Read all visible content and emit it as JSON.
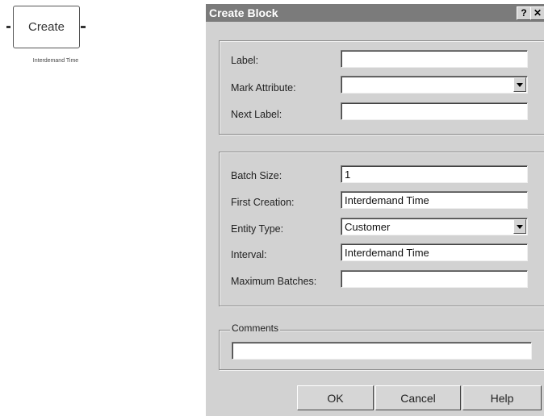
{
  "block": {
    "label": "Create",
    "caption": "Interdemand Time"
  },
  "dialog": {
    "title": "Create Block",
    "help_glyph": "?",
    "close_glyph": "✕",
    "group1": {
      "label_label": "Label:",
      "label_value": "",
      "mark_attribute_label": "Mark Attribute:",
      "mark_attribute_value": "",
      "next_label_label": "Next Label:",
      "next_label_value": ""
    },
    "group2": {
      "batch_size_label": "Batch Size:",
      "batch_size_value": "1",
      "first_creation_label": "First Creation:",
      "first_creation_value": "Interdemand Time",
      "entity_type_label": "Entity Type:",
      "entity_type_value": "Customer",
      "interval_label": "Interval:",
      "interval_value": "Interdemand Time",
      "maximum_batches_label": "Maximum Batches:",
      "maximum_batches_value": ""
    },
    "comments": {
      "legend": "Comments",
      "value": ""
    },
    "buttons": {
      "ok": "OK",
      "cancel": "Cancel",
      "help": "Help"
    }
  }
}
